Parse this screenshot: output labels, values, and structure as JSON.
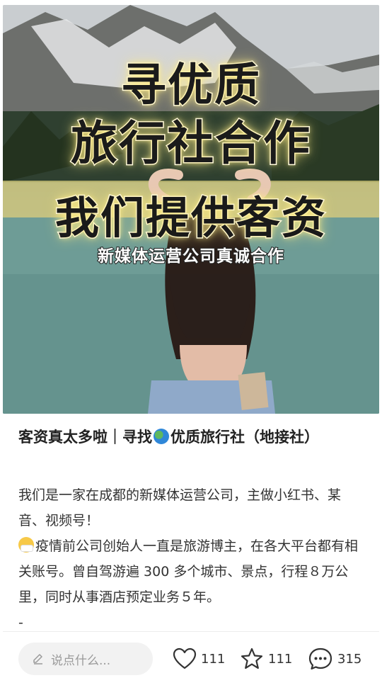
{
  "cover": {
    "line1": "寻优质",
    "line2": "旅行社合作",
    "line3": "我们提供客资",
    "subtitle": "新媒体运营公司真诚合作"
  },
  "post": {
    "title_part1": "客资真太多啦｜寻找",
    "title_part2": "优质旅行社（地接社）",
    "para1": "我们是一家在成都的新媒体运营公司，主做小红书、某音、视频号！",
    "para2": "疫情前公司创始人一直是旅游博主，在各大平台都有相关账号。曾自驾游遍 300 多个城市、景点，行程８万公里，同时从事酒店预定业务５年。",
    "para3": "-"
  },
  "bottom_bar": {
    "comment_placeholder": "说点什么...",
    "likes": "111",
    "favorites": "111",
    "comments": "315"
  }
}
